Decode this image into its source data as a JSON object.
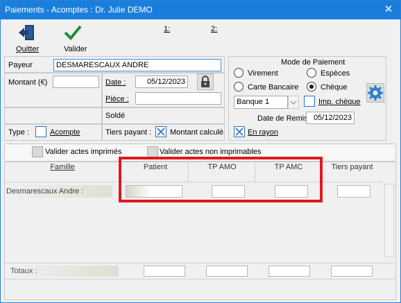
{
  "window": {
    "title": "Paiements - Acomptes : Dr. Julie DEMO",
    "close": "✕"
  },
  "toolbar": {
    "quit_label": "Quitter",
    "validate_label": "Valider",
    "marker1": "1:",
    "marker2": "2:"
  },
  "payer": {
    "label": "Payeur",
    "value": "DESMARESCAUX ANDRE"
  },
  "amount": {
    "label": "Montant (€)",
    "value": ""
  },
  "date": {
    "label": "Date :",
    "value": "05/12/2023"
  },
  "piece": {
    "label": "Pièce :",
    "value": ""
  },
  "solde": {
    "label": "Soldé"
  },
  "type": {
    "label": "Type :",
    "acompte_label": "Acompte",
    "acompte_checked": false
  },
  "tiers": {
    "label": "Tiers payant :",
    "montant_calcule_label": "Montant calculé",
    "montant_calcule_checked": true
  },
  "payment_mode": {
    "title": "Mode de Paiement",
    "options": [
      "Virement",
      "Espèces",
      "Carte Bancaire",
      "Chèque"
    ],
    "selected": "Chèque",
    "bank": "Banque 1",
    "imp_cheque_label": "Imp. chèque",
    "imp_cheque_checked": false,
    "remise_label": "Date de Remise",
    "remise_value": "05/12/2023",
    "en_rayon_label": "En rayon",
    "en_rayon_checked": true
  },
  "actions": {
    "valider_imprimes": "Valider actes imprimés",
    "valider_non_imprimables": "Valider actes non imprimables"
  },
  "table": {
    "headers": [
      "Famille",
      "Patient",
      "TP AMO",
      "TP AMC",
      "Tiers payant"
    ],
    "rows": [
      {
        "famille": "Desmarescaux Andre :"
      }
    ],
    "totals_label": "Totaux :"
  },
  "colors": {
    "titlebar": "#1a7fdc",
    "highlight": "#e0181e",
    "check_mark": "#2a6fc8"
  }
}
